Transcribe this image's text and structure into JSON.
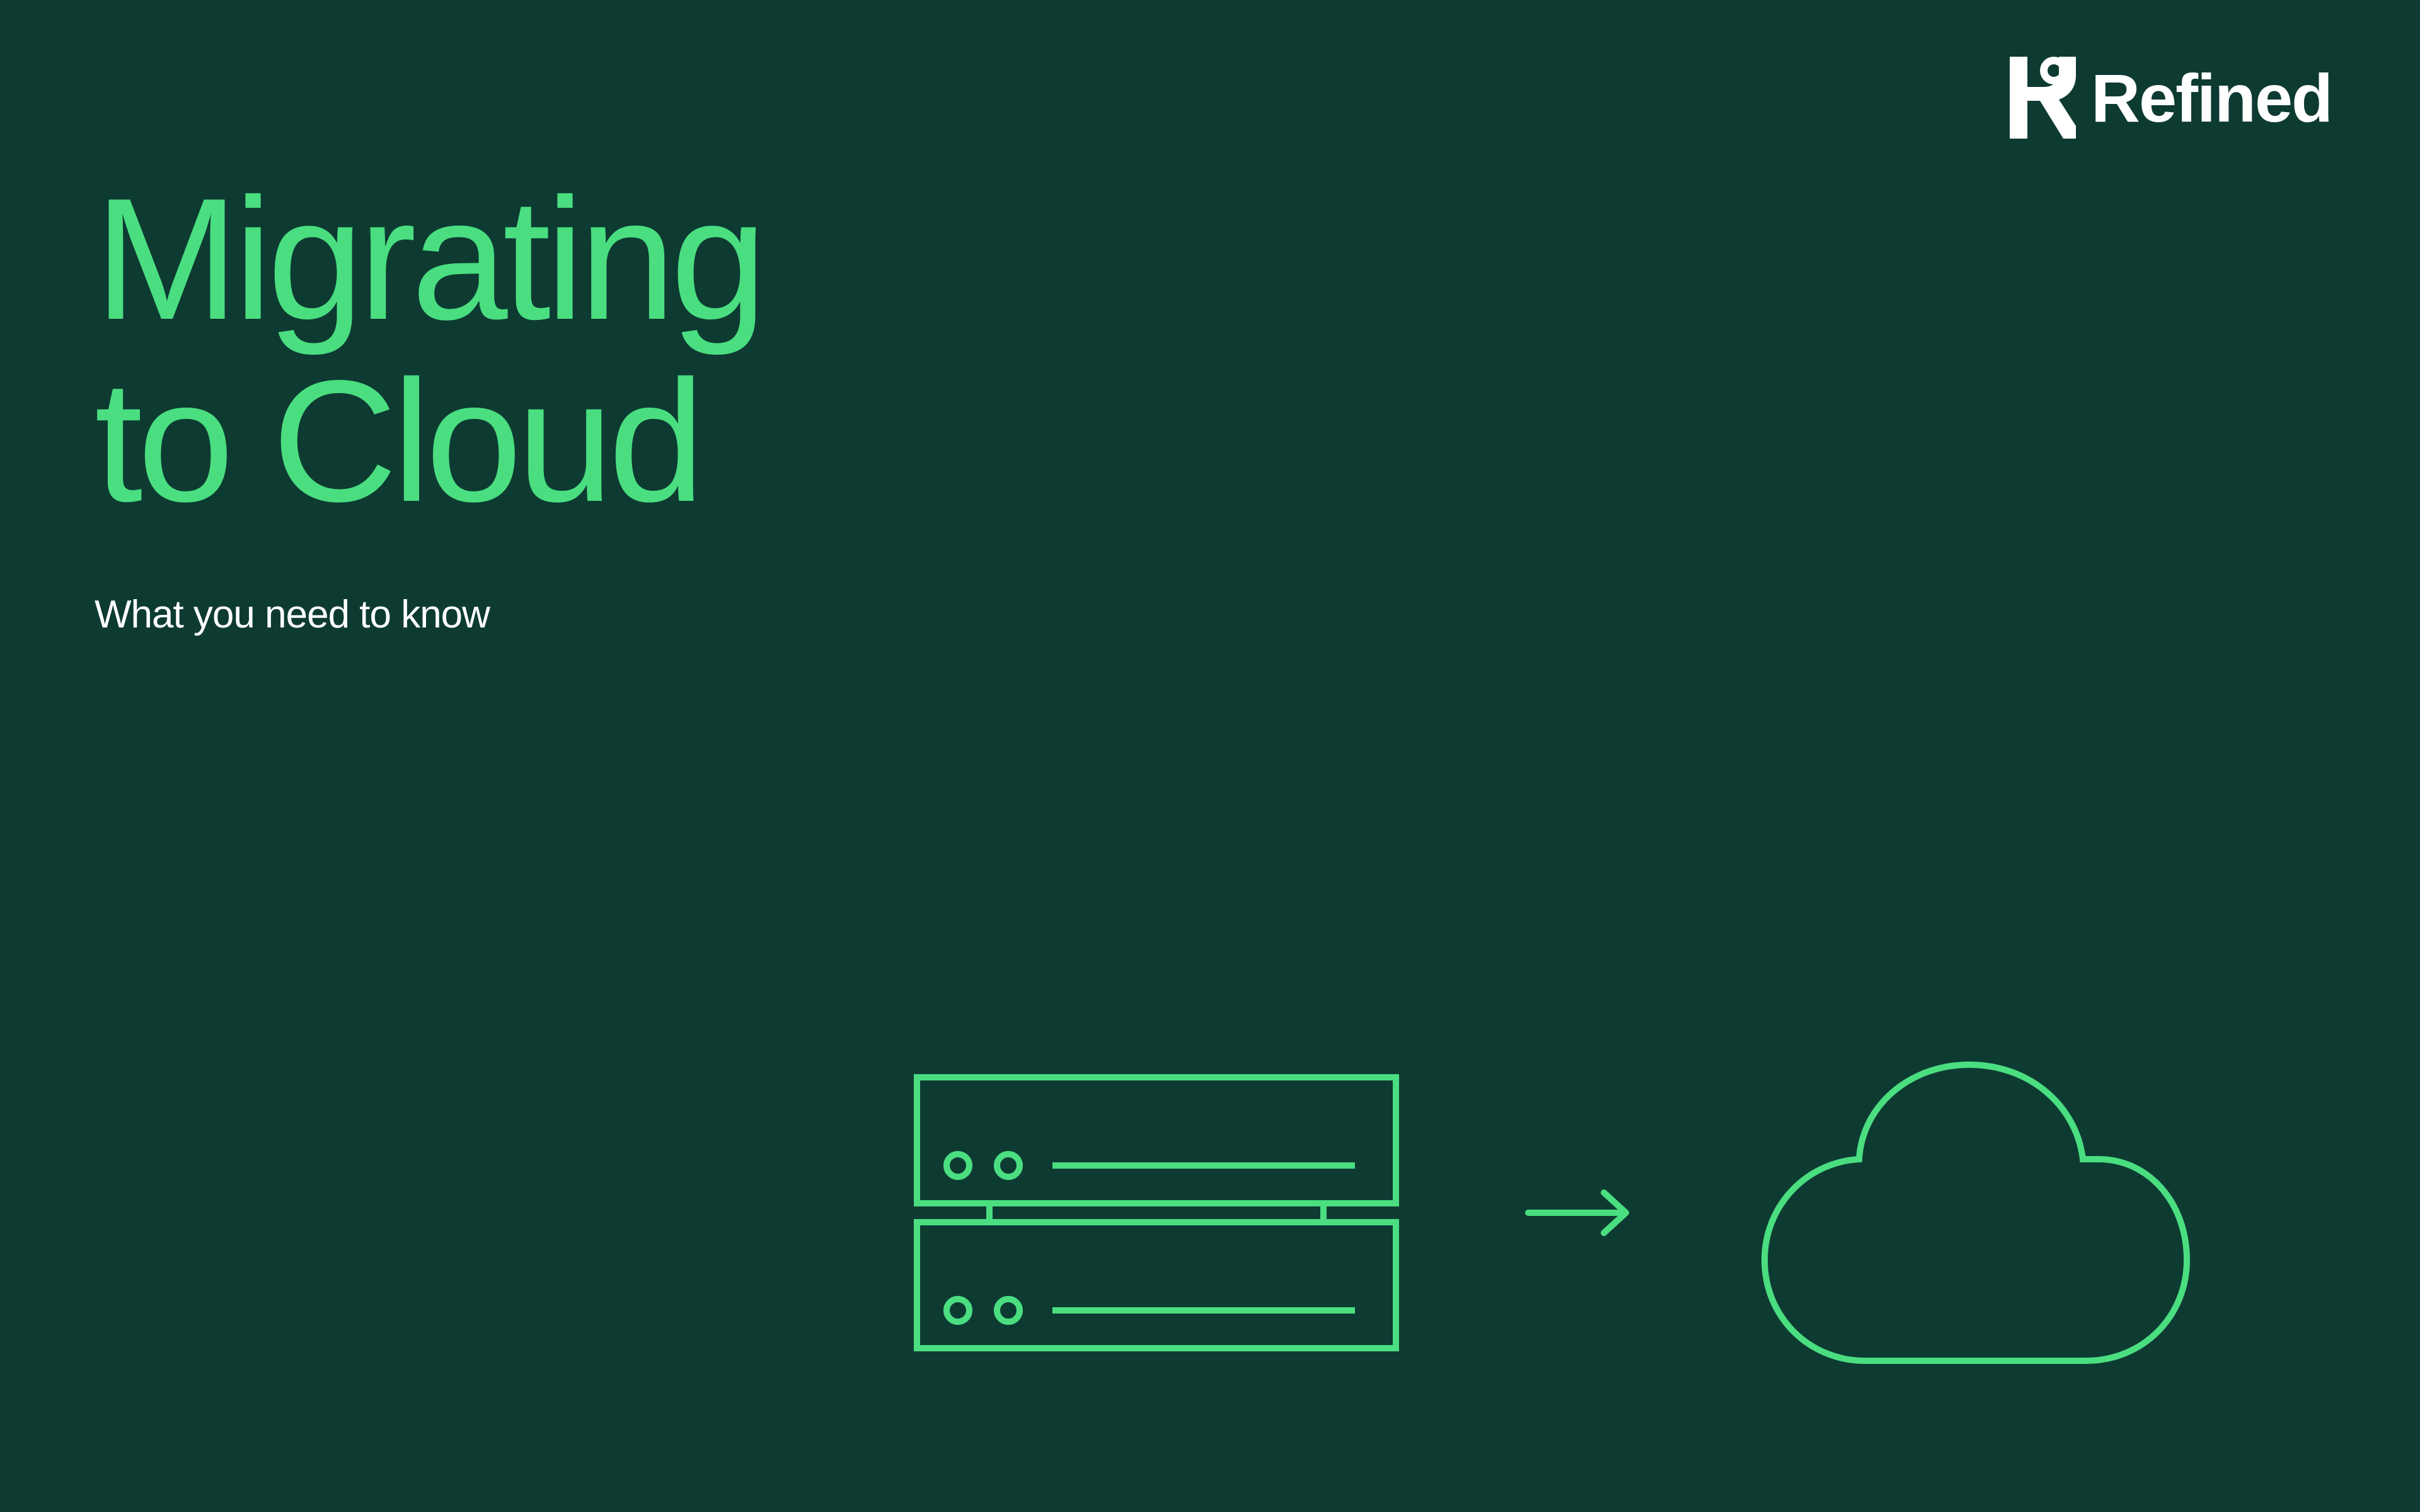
{
  "logo": {
    "brand": "Refined"
  },
  "content": {
    "headline_line1": "Migrating",
    "headline_line2": "to Cloud",
    "subheadline": "What you need to know"
  },
  "colors": {
    "background": "#0d3b32",
    "accent": "#4ade80",
    "text_light": "#ffffff"
  },
  "icons": {
    "server": "server-icon",
    "arrow": "arrow-right-icon",
    "cloud": "cloud-icon"
  }
}
